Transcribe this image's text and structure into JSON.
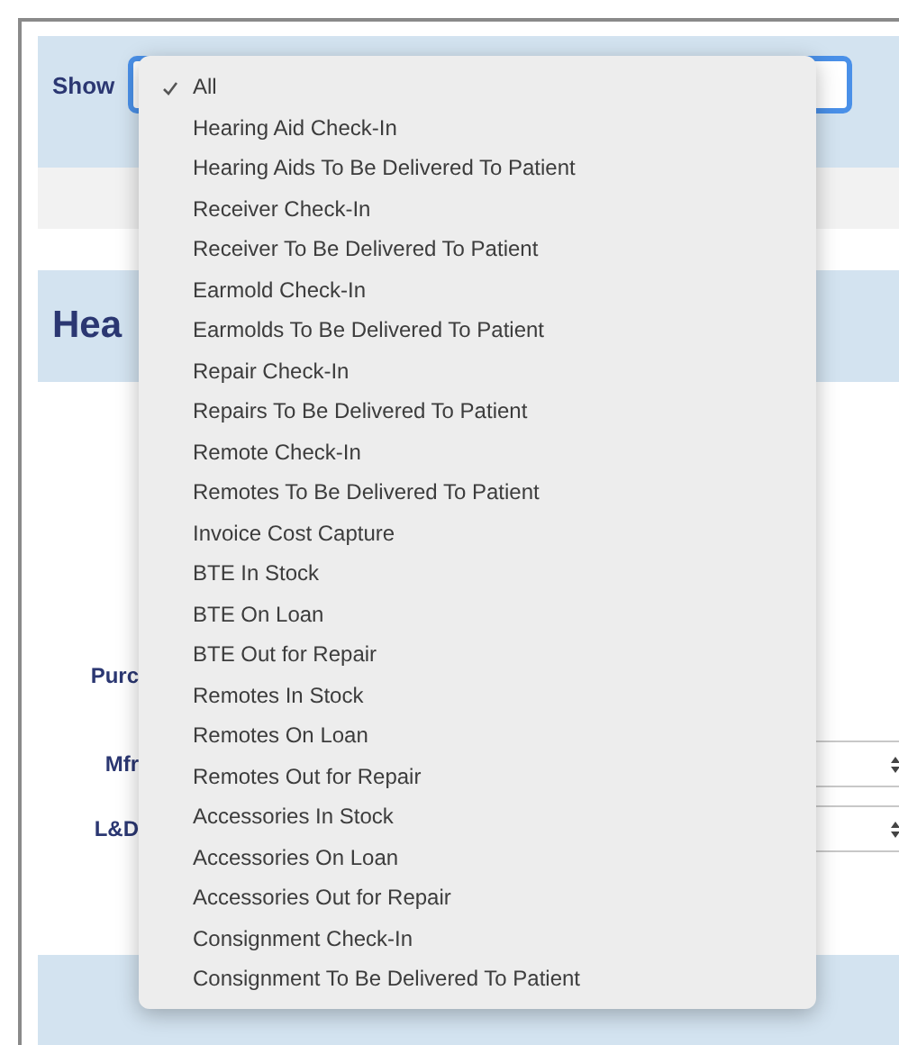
{
  "filter": {
    "label": "Show",
    "focused": true
  },
  "section": {
    "heading": "Hea"
  },
  "form_rows": [
    {
      "label": "Purc",
      "kind": "text"
    },
    {
      "label": "Mfr",
      "kind": "select"
    },
    {
      "label": "L&D",
      "kind": "select"
    }
  ],
  "menu": {
    "items": [
      {
        "label": "All",
        "selected": true
      },
      {
        "label": "Hearing Aid Check-In",
        "selected": false
      },
      {
        "label": "Hearing Aids To Be Delivered To Patient",
        "selected": false
      },
      {
        "label": "Receiver Check-In",
        "selected": false
      },
      {
        "label": "Receiver To Be Delivered To Patient",
        "selected": false
      },
      {
        "label": "Earmold Check-In",
        "selected": false
      },
      {
        "label": "Earmolds To Be Delivered To Patient",
        "selected": false
      },
      {
        "label": "Repair Check-In",
        "selected": false
      },
      {
        "label": "Repairs To Be Delivered To Patient",
        "selected": false
      },
      {
        "label": "Remote Check-In",
        "selected": false
      },
      {
        "label": "Remotes To Be Delivered To Patient",
        "selected": false
      },
      {
        "label": "Invoice Cost Capture",
        "selected": false
      },
      {
        "label": "BTE In Stock",
        "selected": false
      },
      {
        "label": "BTE On Loan",
        "selected": false
      },
      {
        "label": "BTE Out for Repair",
        "selected": false
      },
      {
        "label": "Remotes In Stock",
        "selected": false
      },
      {
        "label": "Remotes On Loan",
        "selected": false
      },
      {
        "label": "Remotes Out for Repair",
        "selected": false
      },
      {
        "label": "Accessories In Stock",
        "selected": false
      },
      {
        "label": "Accessories On Loan",
        "selected": false
      },
      {
        "label": "Accessories Out for Repair",
        "selected": false
      },
      {
        "label": "Consignment Check-In",
        "selected": false
      },
      {
        "label": "Consignment To Be Delivered To Patient",
        "selected": false
      }
    ]
  }
}
